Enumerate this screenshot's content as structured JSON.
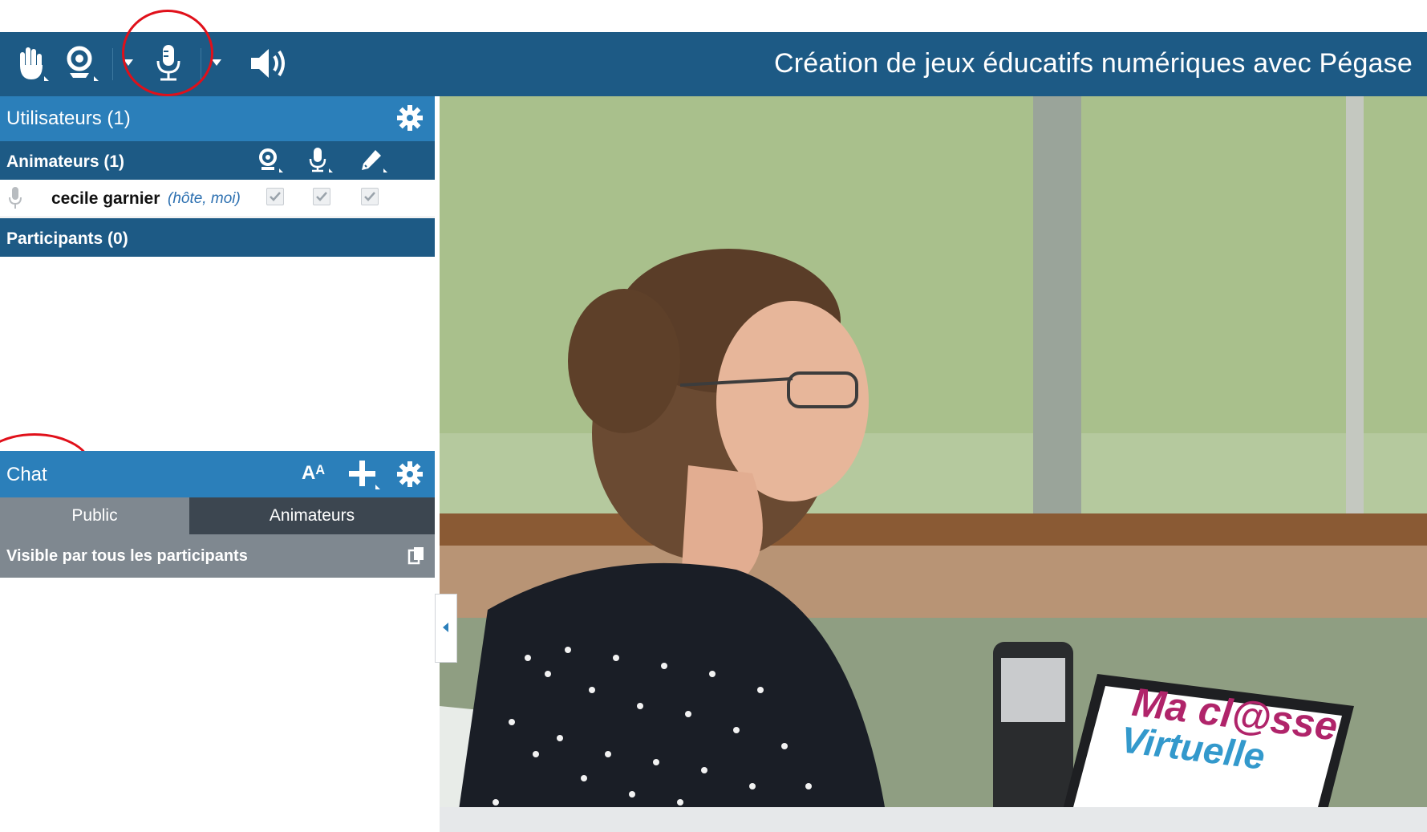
{
  "toolbar": {
    "title": "Création de jeux éducatifs numériques avec Pégase",
    "icons": [
      "raise-hand-icon",
      "webcam-icon",
      "microphone-icon",
      "speaker-icon"
    ]
  },
  "users_panel": {
    "header": "Utilisateurs (1)",
    "animators_header": "Animateurs (1)",
    "user_name": "cecile garnier",
    "user_role": "(hôte, moi)",
    "participants_header": "Participants (0)"
  },
  "chat_panel": {
    "header": "Chat",
    "font_button": "Aᴬ",
    "tabs": [
      "Public",
      "Animateurs"
    ],
    "visibility": "Visible par tous les participants"
  },
  "content": {
    "logo_line1": "Ma cl@sse",
    "logo_line2": "Virtuelle"
  },
  "colors": {
    "toolbar_bg": "#1d5a85",
    "panel_header": "#2b7fba",
    "annotation": "#e0101a"
  }
}
